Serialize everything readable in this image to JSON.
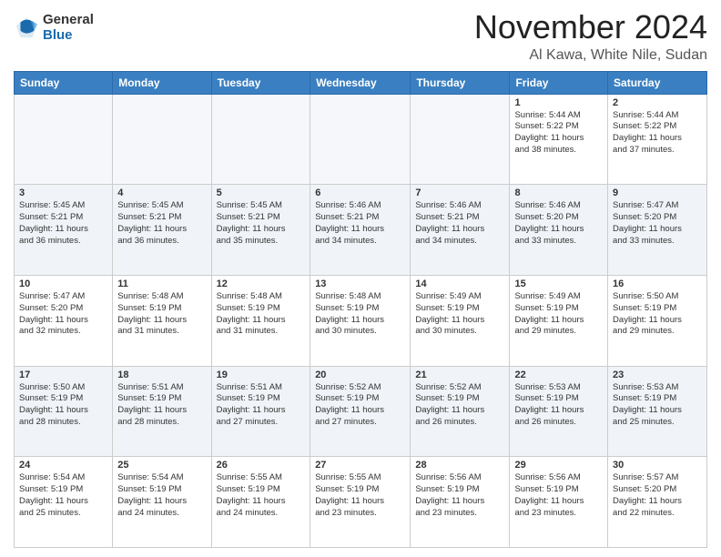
{
  "logo": {
    "general": "General",
    "blue": "Blue"
  },
  "header": {
    "month": "November 2024",
    "location": "Al Kawa, White Nile, Sudan"
  },
  "weekdays": [
    "Sunday",
    "Monday",
    "Tuesday",
    "Wednesday",
    "Thursday",
    "Friday",
    "Saturday"
  ],
  "weeks": [
    [
      {
        "day": "",
        "info": ""
      },
      {
        "day": "",
        "info": ""
      },
      {
        "day": "",
        "info": ""
      },
      {
        "day": "",
        "info": ""
      },
      {
        "day": "",
        "info": ""
      },
      {
        "day": "1",
        "info": "Sunrise: 5:44 AM\nSunset: 5:22 PM\nDaylight: 11 hours\nand 38 minutes."
      },
      {
        "day": "2",
        "info": "Sunrise: 5:44 AM\nSunset: 5:22 PM\nDaylight: 11 hours\nand 37 minutes."
      }
    ],
    [
      {
        "day": "3",
        "info": "Sunrise: 5:45 AM\nSunset: 5:21 PM\nDaylight: 11 hours\nand 36 minutes."
      },
      {
        "day": "4",
        "info": "Sunrise: 5:45 AM\nSunset: 5:21 PM\nDaylight: 11 hours\nand 36 minutes."
      },
      {
        "day": "5",
        "info": "Sunrise: 5:45 AM\nSunset: 5:21 PM\nDaylight: 11 hours\nand 35 minutes."
      },
      {
        "day": "6",
        "info": "Sunrise: 5:46 AM\nSunset: 5:21 PM\nDaylight: 11 hours\nand 34 minutes."
      },
      {
        "day": "7",
        "info": "Sunrise: 5:46 AM\nSunset: 5:21 PM\nDaylight: 11 hours\nand 34 minutes."
      },
      {
        "day": "8",
        "info": "Sunrise: 5:46 AM\nSunset: 5:20 PM\nDaylight: 11 hours\nand 33 minutes."
      },
      {
        "day": "9",
        "info": "Sunrise: 5:47 AM\nSunset: 5:20 PM\nDaylight: 11 hours\nand 33 minutes."
      }
    ],
    [
      {
        "day": "10",
        "info": "Sunrise: 5:47 AM\nSunset: 5:20 PM\nDaylight: 11 hours\nand 32 minutes."
      },
      {
        "day": "11",
        "info": "Sunrise: 5:48 AM\nSunset: 5:19 PM\nDaylight: 11 hours\nand 31 minutes."
      },
      {
        "day": "12",
        "info": "Sunrise: 5:48 AM\nSunset: 5:19 PM\nDaylight: 11 hours\nand 31 minutes."
      },
      {
        "day": "13",
        "info": "Sunrise: 5:48 AM\nSunset: 5:19 PM\nDaylight: 11 hours\nand 30 minutes."
      },
      {
        "day": "14",
        "info": "Sunrise: 5:49 AM\nSunset: 5:19 PM\nDaylight: 11 hours\nand 30 minutes."
      },
      {
        "day": "15",
        "info": "Sunrise: 5:49 AM\nSunset: 5:19 PM\nDaylight: 11 hours\nand 29 minutes."
      },
      {
        "day": "16",
        "info": "Sunrise: 5:50 AM\nSunset: 5:19 PM\nDaylight: 11 hours\nand 29 minutes."
      }
    ],
    [
      {
        "day": "17",
        "info": "Sunrise: 5:50 AM\nSunset: 5:19 PM\nDaylight: 11 hours\nand 28 minutes."
      },
      {
        "day": "18",
        "info": "Sunrise: 5:51 AM\nSunset: 5:19 PM\nDaylight: 11 hours\nand 28 minutes."
      },
      {
        "day": "19",
        "info": "Sunrise: 5:51 AM\nSunset: 5:19 PM\nDaylight: 11 hours\nand 27 minutes."
      },
      {
        "day": "20",
        "info": "Sunrise: 5:52 AM\nSunset: 5:19 PM\nDaylight: 11 hours\nand 27 minutes."
      },
      {
        "day": "21",
        "info": "Sunrise: 5:52 AM\nSunset: 5:19 PM\nDaylight: 11 hours\nand 26 minutes."
      },
      {
        "day": "22",
        "info": "Sunrise: 5:53 AM\nSunset: 5:19 PM\nDaylight: 11 hours\nand 26 minutes."
      },
      {
        "day": "23",
        "info": "Sunrise: 5:53 AM\nSunset: 5:19 PM\nDaylight: 11 hours\nand 25 minutes."
      }
    ],
    [
      {
        "day": "24",
        "info": "Sunrise: 5:54 AM\nSunset: 5:19 PM\nDaylight: 11 hours\nand 25 minutes."
      },
      {
        "day": "25",
        "info": "Sunrise: 5:54 AM\nSunset: 5:19 PM\nDaylight: 11 hours\nand 24 minutes."
      },
      {
        "day": "26",
        "info": "Sunrise: 5:55 AM\nSunset: 5:19 PM\nDaylight: 11 hours\nand 24 minutes."
      },
      {
        "day": "27",
        "info": "Sunrise: 5:55 AM\nSunset: 5:19 PM\nDaylight: 11 hours\nand 23 minutes."
      },
      {
        "day": "28",
        "info": "Sunrise: 5:56 AM\nSunset: 5:19 PM\nDaylight: 11 hours\nand 23 minutes."
      },
      {
        "day": "29",
        "info": "Sunrise: 5:56 AM\nSunset: 5:19 PM\nDaylight: 11 hours\nand 23 minutes."
      },
      {
        "day": "30",
        "info": "Sunrise: 5:57 AM\nSunset: 5:20 PM\nDaylight: 11 hours\nand 22 minutes."
      }
    ]
  ]
}
